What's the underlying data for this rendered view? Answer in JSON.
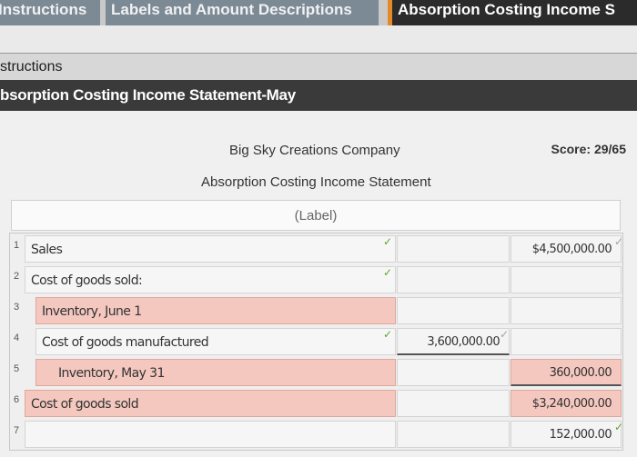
{
  "tabs": [
    {
      "label": "Instructions"
    },
    {
      "label": "Labels and Amount Descriptions"
    },
    {
      "label": "Absorption Costing Income S"
    }
  ],
  "instructions_bar": {
    "label": "structions"
  },
  "title_bar": {
    "label": "bsorption Costing Income Statement-May"
  },
  "statement": {
    "company": "Big Sky Creations Company",
    "title": "Absorption Costing Income Statement",
    "label_placeholder": "(Label)",
    "score": "Score: 29/65"
  },
  "rows": [
    {
      "num": "1",
      "label": "Sales",
      "mid": "",
      "right": "$4,500,000.00"
    },
    {
      "num": "2",
      "label": "Cost of goods sold:",
      "mid": "",
      "right": ""
    },
    {
      "num": "3",
      "label": "Inventory, June 1",
      "mid": "",
      "right": ""
    },
    {
      "num": "4",
      "label": "Cost of goods manufactured",
      "mid": "3,600,000.00",
      "right": ""
    },
    {
      "num": "5",
      "label": "Inventory, May 31",
      "mid": "",
      "right": "360,000.00"
    },
    {
      "num": "6",
      "label": "Cost of goods sold",
      "mid": "",
      "right": "$3,240,000.00"
    },
    {
      "num": "7",
      "label": "",
      "mid": "",
      "right": "152,000.00"
    }
  ],
  "colors": {
    "accent_tab": "#e48a2a",
    "incorrect_fill": "#f4c7bf",
    "check_green": "#5aa532"
  },
  "icons": {
    "correct": "check-icon"
  }
}
